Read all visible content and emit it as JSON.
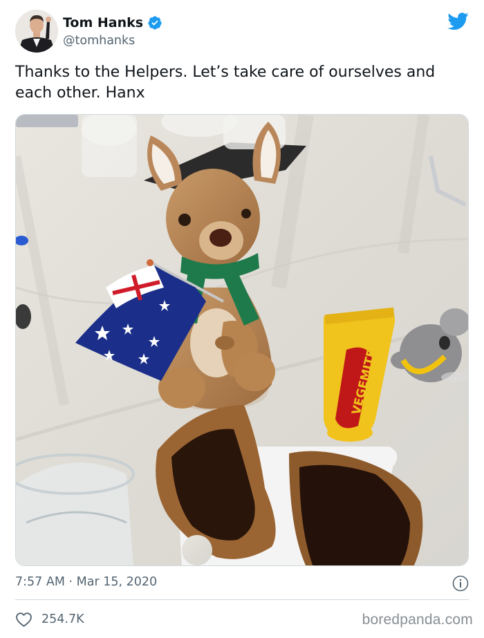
{
  "author": {
    "display_name": "Tom Hanks",
    "handle": "@tomhanks",
    "verified": true,
    "avatar_icon": "avatar-photo"
  },
  "tweet": {
    "text": "Thanks to the Helpers. Let’s take care of ourselves and each other. Hanx",
    "media_description": "photo",
    "timestamp": "7:57 AM · Mar 15, 2020",
    "likes": "254.7K"
  },
  "photo_labels": {
    "vegemite": "VEGEMITE"
  },
  "icons": {
    "platform": "twitter-bird-icon",
    "verified": "verified-badge-icon",
    "info": "info-icon",
    "like": "heart-icon"
  },
  "colors": {
    "brand_blue": "#1d9bf0",
    "text_primary": "#0f1419",
    "text_secondary": "#536471",
    "divider": "#cfd9de",
    "watermark": "#888e93"
  },
  "watermark": "boredpanda.com"
}
